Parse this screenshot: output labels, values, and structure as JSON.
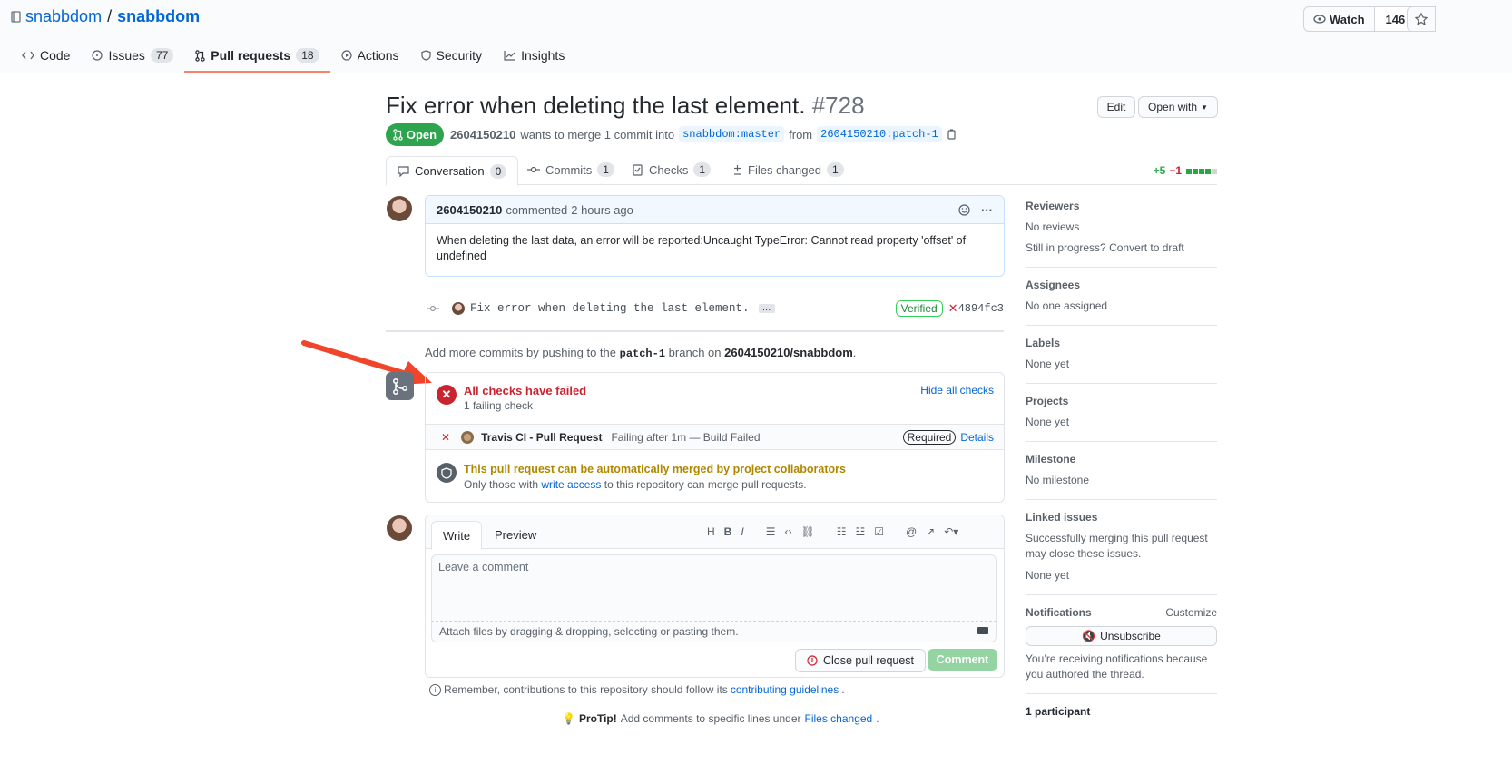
{
  "repo": {
    "owner": "snabbdom",
    "sep": "/",
    "name": "snabbdom"
  },
  "watch": {
    "label": "Watch",
    "count": "146"
  },
  "nav": [
    {
      "label": "Code",
      "count": null,
      "active": false,
      "icon": "code-icon"
    },
    {
      "label": "Issues",
      "count": "77",
      "active": false,
      "icon": "issue-icon"
    },
    {
      "label": "Pull requests",
      "count": "18",
      "active": true,
      "icon": "pull-request-icon"
    },
    {
      "label": "Actions",
      "count": null,
      "active": false,
      "icon": "play-icon"
    },
    {
      "label": "Security",
      "count": null,
      "active": false,
      "icon": "shield-icon"
    },
    {
      "label": "Insights",
      "count": null,
      "active": false,
      "icon": "graph-icon"
    }
  ],
  "pr": {
    "title": "Fix error when deleting the last element.",
    "number": "#728",
    "state": "Open",
    "author": "2604150210",
    "merge_text": "wants to merge 1 commit into",
    "base": "snabbdom:master",
    "from": "from",
    "head": "2604150210:patch-1",
    "edit_label": "Edit",
    "open_with_label": "Open with"
  },
  "pr_tabs": [
    {
      "label": "Conversation",
      "count": "0"
    },
    {
      "label": "Commits",
      "count": "1"
    },
    {
      "label": "Checks",
      "count": "1"
    },
    {
      "label": "Files changed",
      "count": "1"
    }
  ],
  "diffstat": {
    "added": "+5",
    "removed": "−1",
    "colors": [
      "#28a745",
      "#28a745",
      "#28a745",
      "#28a745",
      "#d1d5da"
    ]
  },
  "comment": {
    "author": "2604150210",
    "action": "commented",
    "time": "2 hours ago",
    "body": "When deleting the last data, an error will be reported:Uncaught TypeError: Cannot read property 'offset' of undefined"
  },
  "commit": {
    "message": "Fix error when deleting the last element.",
    "ellipsis": "…",
    "verified": "Verified",
    "sha": "4894fc3"
  },
  "push_hint": {
    "pre": "Add more commits by pushing to the",
    "branch": "patch-1",
    "mid": "branch on",
    "repo": "2604150210/snabbdom",
    "post": "."
  },
  "checks": {
    "title": "All checks have failed",
    "subtitle": "1 failing check",
    "toggle": "Hide all checks",
    "item_name": "Travis CI - Pull Request",
    "item_status": "Failing after 1m — Build Failed",
    "required": "Required",
    "details": "Details",
    "merge_title": "This pull request can be automatically merged by project collaborators",
    "merge_pre": "Only those with",
    "merge_link": "write access",
    "merge_post": "to this repository can merge pull requests."
  },
  "editor": {
    "tab_write": "Write",
    "tab_preview": "Preview",
    "placeholder": "Leave a comment",
    "attach": "Attach files by dragging & dropping, selecting or pasting them.",
    "close_label": "Close pull request",
    "comment_label": "Comment"
  },
  "footer": {
    "remember_pre": "Remember, contributions to this repository should follow its",
    "remember_link": "contributing guidelines",
    "remember_post": ".",
    "protip_bold": "ProTip!",
    "protip_text": "Add comments to specific lines under",
    "protip_link": "Files changed",
    "protip_post": "."
  },
  "sidebar": {
    "reviewers": {
      "title": "Reviewers",
      "text": "No reviews",
      "text2": "Still in progress?",
      "link": "Convert to draft"
    },
    "assignees": {
      "title": "Assignees",
      "text": "No one assigned"
    },
    "labels": {
      "title": "Labels",
      "text": "None yet"
    },
    "projects": {
      "title": "Projects",
      "text": "None yet"
    },
    "milestone": {
      "title": "Milestone",
      "text": "No milestone"
    },
    "linked": {
      "title": "Linked issues",
      "text": "Successfully merging this pull request may close these issues.",
      "text2": "None yet"
    },
    "notifications": {
      "title": "Notifications",
      "customize": "Customize",
      "button": "Unsubscribe",
      "text": "You’re receiving notifications because you authored the thread."
    },
    "participants": {
      "title": "1 participant"
    }
  },
  "colors": {
    "accent": "#0366d6",
    "open": "#2ea44f",
    "fail": "#cb2431",
    "warn": "#b08800",
    "annotation_arrow": "#f0452b"
  }
}
